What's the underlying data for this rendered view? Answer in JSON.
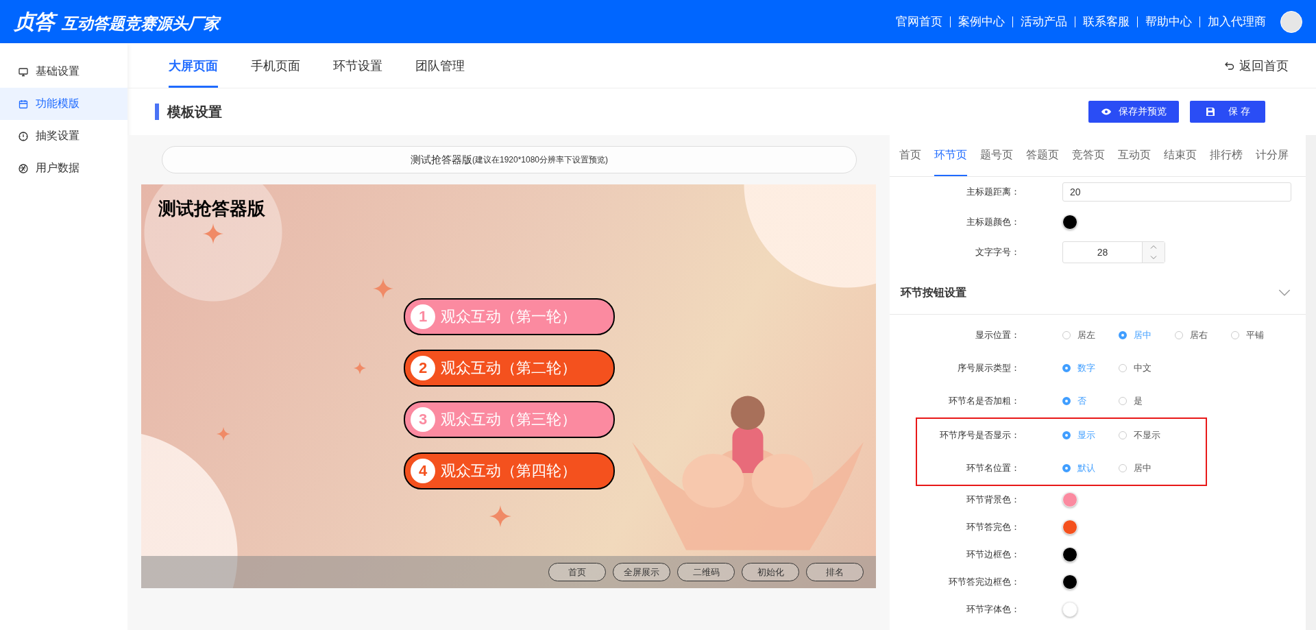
{
  "header": {
    "logo": "贞答",
    "slogan": "互动答题竞赛源头厂家",
    "nav": [
      "官网首页",
      "案例中心",
      "活动产品",
      "联系客服",
      "帮助中心",
      "加入代理商"
    ]
  },
  "sidebar": {
    "items": [
      {
        "label": "基础设置",
        "selected": false
      },
      {
        "label": "功能模版",
        "selected": true
      },
      {
        "label": "抽奖设置",
        "selected": false
      },
      {
        "label": "用户数据",
        "selected": false
      }
    ]
  },
  "top_tabs": [
    {
      "label": "大屏页面",
      "selected": true
    },
    {
      "label": "手机页面",
      "selected": false
    },
    {
      "label": "环节设置",
      "selected": false
    },
    {
      "label": "团队管理",
      "selected": false
    }
  ],
  "back_link": "返回首页",
  "section_title": "模板设置",
  "buttons": [
    {
      "label": "保存并预览",
      "kind": "preview"
    },
    {
      "label": "保 存",
      "kind": "save"
    }
  ],
  "preview": {
    "banner_title": "测试抢答器版",
    "banner_hint": "(建议在1920*1080分辨率下设置预览)",
    "screen_title": "测试抢答器版",
    "rounds": [
      {
        "number": "1",
        "name": "观众互动（第一轮）",
        "answered": false
      },
      {
        "number": "2",
        "name": "观众互动（第二轮）",
        "answered": true
      },
      {
        "number": "3",
        "name": "观众互动（第三轮）",
        "answered": false
      },
      {
        "number": "4",
        "name": "观众互动（第四轮）",
        "answered": true
      }
    ],
    "controls": [
      "首页",
      "全屏展示",
      "二维码",
      "初始化",
      "排名"
    ]
  },
  "settings": {
    "tabs": [
      {
        "label": "首页",
        "selected": false
      },
      {
        "label": "环节页",
        "selected": true
      },
      {
        "label": "题号页",
        "selected": false
      },
      {
        "label": "答题页",
        "selected": false
      },
      {
        "label": "竞答页",
        "selected": false
      },
      {
        "label": "互动页",
        "selected": false
      },
      {
        "label": "结束页",
        "selected": false
      },
      {
        "label": "排行榜",
        "selected": false
      },
      {
        "label": "计分屏",
        "selected": false
      }
    ],
    "fields": [
      {
        "kind": "text",
        "label": "主标题距离：",
        "value": "20"
      },
      {
        "kind": "color",
        "label": "主标题颜色：",
        "color": "#000000"
      },
      {
        "kind": "number",
        "label": "文字字号：",
        "value": "28"
      }
    ],
    "group": {
      "title": "环节按钮设置",
      "expanded": true
    },
    "rows": [
      {
        "kind": "radio",
        "label": "显示位置：",
        "highlighted": false,
        "options": [
          {
            "label": "居左",
            "selected": false
          },
          {
            "label": "居中",
            "selected": true
          },
          {
            "label": "居右",
            "selected": false
          },
          {
            "label": "平铺",
            "selected": false
          }
        ]
      },
      {
        "kind": "radio",
        "label": "序号展示类型：",
        "highlighted": false,
        "options": [
          {
            "label": "数字",
            "selected": true
          },
          {
            "label": "中文",
            "selected": false
          }
        ]
      },
      {
        "kind": "radio",
        "label": "环节名是否加粗：",
        "highlighted": false,
        "options": [
          {
            "label": "否",
            "selected": true
          },
          {
            "label": "是",
            "selected": false
          }
        ]
      },
      {
        "kind": "radio",
        "label": "环节序号是否显示：",
        "highlighted": true,
        "options": [
          {
            "label": "显示",
            "selected": true
          },
          {
            "label": "不显示",
            "selected": false
          }
        ]
      },
      {
        "kind": "radio",
        "label": "环节名位置：",
        "highlighted": true,
        "options": [
          {
            "label": "默认",
            "selected": true
          },
          {
            "label": "居中",
            "selected": false
          }
        ]
      },
      {
        "kind": "color",
        "label": "环节背景色：",
        "highlighted": false,
        "color": "#fb8aa0"
      },
      {
        "kind": "color",
        "label": "环节答完色：",
        "highlighted": false,
        "color": "#f4511e"
      },
      {
        "kind": "color",
        "label": "环节边框色：",
        "highlighted": false,
        "color": "#000000"
      },
      {
        "kind": "color",
        "label": "环节答完边框色：",
        "highlighted": false,
        "color": "#000000"
      },
      {
        "kind": "color",
        "label": "环节字体色：",
        "highlighted": false,
        "color": "#ffffff"
      }
    ]
  }
}
